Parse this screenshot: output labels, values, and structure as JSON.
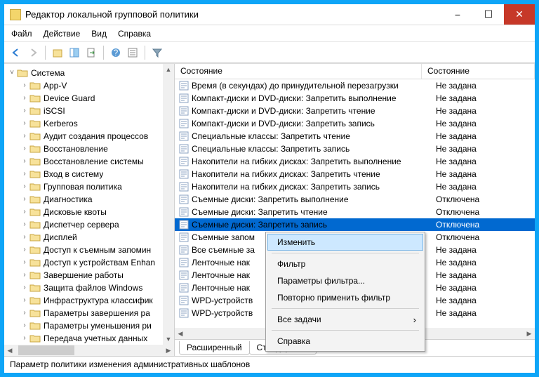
{
  "window": {
    "title": "Редактор локальной групповой политики"
  },
  "menu": {
    "file": "Файл",
    "action": "Действие",
    "view": "Вид",
    "help": "Справка"
  },
  "tree": {
    "root": "Система",
    "items": [
      "App-V",
      "Device Guard",
      "iSCSI",
      "Kerberos",
      "Аудит создания процессов",
      "Восстановление",
      "Восстановление системы",
      "Вход в систему",
      "Групповая политика",
      "Диагностика",
      "Дисковые квоты",
      "Диспетчер сервера",
      "Дисплей",
      "Доступ к съемным запомин",
      "Доступ к устройствам Enhan",
      "Завершение работы",
      "Защита файлов Windows",
      "Инфраструктура классифик",
      "Параметры завершения ра",
      "Параметры уменьшения ри",
      "Передача учетных данных"
    ]
  },
  "columns": {
    "c1": "Состояние",
    "c2": "Состояние"
  },
  "rows": [
    {
      "t": "Время (в секундах) до принудительной перезагрузки",
      "s": "Не задана"
    },
    {
      "t": "Компакт-диски и DVD-диски: Запретить выполнение",
      "s": "Не задана"
    },
    {
      "t": "Компакт-диски и DVD-диски: Запретить чтение",
      "s": "Не задана"
    },
    {
      "t": "Компакт-диски и DVD-диски: Запретить запись",
      "s": "Не задана"
    },
    {
      "t": "Специальные классы: Запретить чтение",
      "s": "Не задана"
    },
    {
      "t": "Специальные классы: Запретить запись",
      "s": "Не задана"
    },
    {
      "t": "Накопители на гибких дисках: Запретить выполнение",
      "s": "Не задана"
    },
    {
      "t": "Накопители на гибких дисках: Запретить чтение",
      "s": "Не задана"
    },
    {
      "t": "Накопители на гибких дисках: Запретить запись",
      "s": "Не задана"
    },
    {
      "t": "Съемные диски: Запретить выполнение",
      "s": "Отключена"
    },
    {
      "t": "Съемные диски: Запретить чтение",
      "s": "Отключена"
    },
    {
      "t": "Съемные диски: Запретить запись",
      "s": "Отключена",
      "sel": true
    },
    {
      "t": "Съемные запом",
      "s": "Отключена"
    },
    {
      "t": "Все съемные за",
      "s": "Не задана"
    },
    {
      "t": "Ленточные нак",
      "s": "Не задана"
    },
    {
      "t": "Ленточные нак",
      "s": "Не задана"
    },
    {
      "t": "Ленточные нак",
      "s": "Не задана"
    },
    {
      "t": "WPD-устройств",
      "s": "Не задана"
    },
    {
      "t": "WPD-устройств",
      "s": "Не задана"
    }
  ],
  "tabs": {
    "extended": "Расширенный",
    "standard": "Стандартный"
  },
  "status": "Параметр политики изменения административных шаблонов",
  "ctx": {
    "edit": "Изменить",
    "filter": "Фильтр",
    "filterParams": "Параметры фильтра...",
    "reapply": "Повторно применить фильтр",
    "alltasks": "Все задачи",
    "help": "Справка"
  }
}
